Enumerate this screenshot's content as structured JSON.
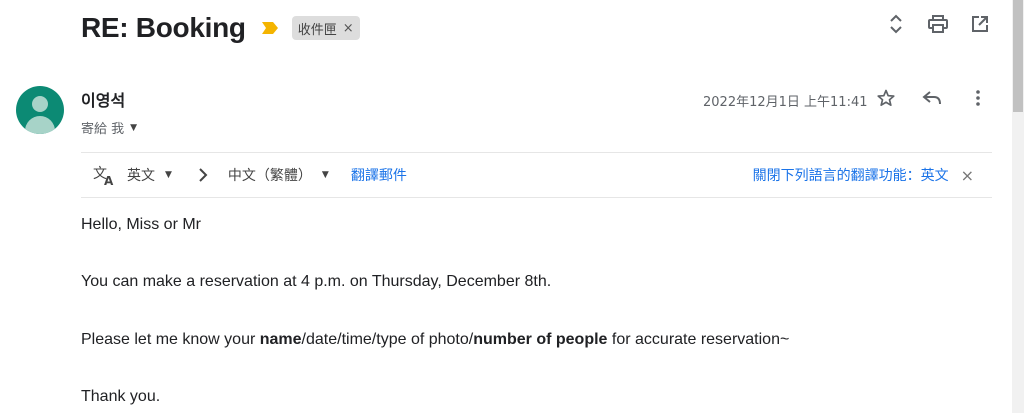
{
  "email": {
    "subject": "RE: Booking",
    "label": "收件匣",
    "label_remove": "×"
  },
  "message": {
    "sender": "이영석",
    "recipient_prefix": "寄給 我",
    "date": "2022年12月1日 上午11:41"
  },
  "translate": {
    "source_lang": "英文",
    "target_lang": "中文（繁體）",
    "translate_link": "翻譯郵件",
    "turn_off": "關閉下列語言的翻譯功能：英文"
  },
  "body": {
    "greeting": "Hello, Miss or Mr",
    "line2": "You can make a reservation at 4 p.m. on Thursday, December 8th.",
    "line3_pre": "Please let me know your ",
    "line3_name": "name",
    "line3_mid": "/date/time/type of photo/",
    "line3_people": "number of people",
    "line3_post": " for accurate reservation~",
    "closing": "Thank you."
  },
  "icons": {
    "importance": "importance-marker-icon",
    "expand": "expand-collapse-icon",
    "print": "print-icon",
    "open_new": "open-in-new-window-icon",
    "star": "star-icon",
    "reply": "reply-icon",
    "more": "more-vert-icon",
    "translate": "translate-icon",
    "chevron": "chevron-right-icon"
  },
  "colors": {
    "importance_marker": "#f4b400",
    "link": "#1a73e8",
    "avatar": "#0c8a74"
  }
}
